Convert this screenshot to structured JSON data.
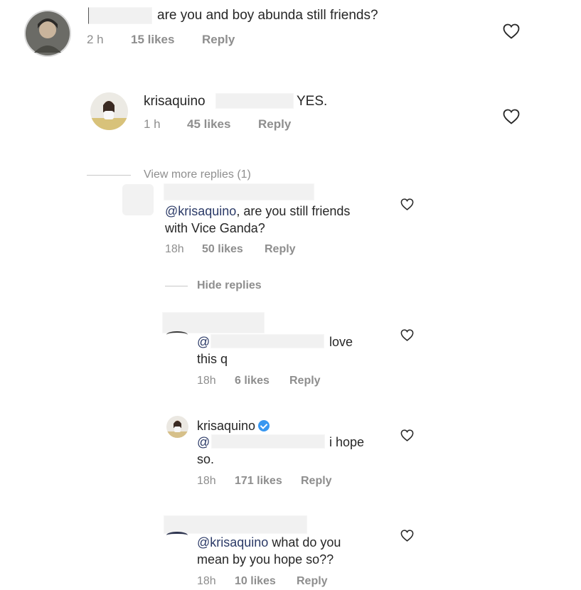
{
  "comments": [
    {
      "id": "c1",
      "username": "",
      "text": "are you and boy abunda still friends?",
      "time": "2 h",
      "likes": "15 likes",
      "reply": "Reply"
    },
    {
      "id": "c2",
      "username": "krisaquino",
      "text": "YES.",
      "time": "1 h",
      "likes": "45 likes",
      "reply": "Reply"
    },
    {
      "id": "c3",
      "username": "",
      "mention": "@krisaquino",
      "text_line1": ", are you still friends",
      "text_line2": "with Vice Ganda?",
      "time": "18h",
      "likes": "50 likes",
      "reply": "Reply"
    },
    {
      "id": "c4",
      "username": "",
      "mention": "@",
      "text_line1": "love",
      "text_line2": "this q",
      "time": "18h",
      "likes": "6 likes",
      "reply": "Reply"
    },
    {
      "id": "c5",
      "username": "krisaquino",
      "mention": "@",
      "text_line1": "i hope",
      "text_line2": "so.",
      "time": "18h",
      "likes": "171 likes",
      "reply": "Reply"
    },
    {
      "id": "c6",
      "username": "",
      "mention": "@krisaquino",
      "text_line1": " what do you",
      "text_line2": "mean by you hope so??",
      "time": "18h",
      "likes": "10 likes",
      "reply": "Reply"
    }
  ],
  "view_more_replies": "View more replies (1)",
  "hide_replies": "Hide replies",
  "icons": {
    "heart": "heart-outline-icon",
    "verified": "verified-badge-icon"
  },
  "colors": {
    "text": "#262626",
    "meta": "#8e8e8e",
    "mention": "#2b3a67",
    "verified": "#3897f0"
  }
}
